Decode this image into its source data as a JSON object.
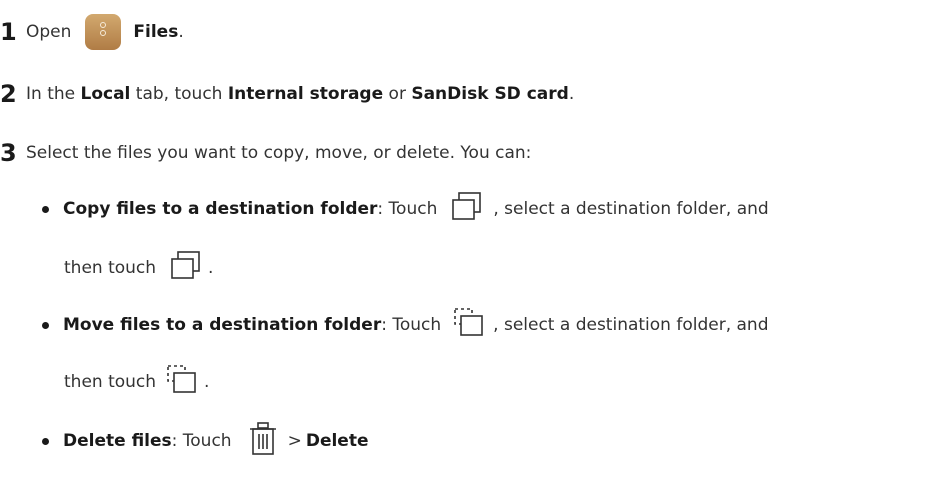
{
  "step1": {
    "number": "1",
    "text_before": "Open",
    "app_name": "Files",
    "text_after": "."
  },
  "step2": {
    "number": "2",
    "t1": "In the",
    "local": "Local",
    "t2": "tab, touch",
    "internal": "Internal storage",
    "t3": "or",
    "sdcard": "SanDisk SD card",
    "t4": "."
  },
  "step3": {
    "number": "3",
    "text": "Select the files you want to copy, move, or delete. You can:"
  },
  "copy": {
    "title": "Copy files to a destination folder",
    "t1": ": Touch",
    "t2": ", select a destination folder, and",
    "t3": "then touch",
    "t4": "."
  },
  "move": {
    "title": "Move files to a destination folder",
    "t1": ": Touch",
    "t2": ", select a destination folder, and",
    "t3": "then touch",
    "t4": "."
  },
  "delete": {
    "title": "Delete files",
    "t1": ": Touch",
    "t2": ">",
    "action": "Delete"
  },
  "icons": {
    "app": "files-app-icon",
    "copy": "copy-icon",
    "move": "move-icon",
    "delete": "trash-icon"
  }
}
